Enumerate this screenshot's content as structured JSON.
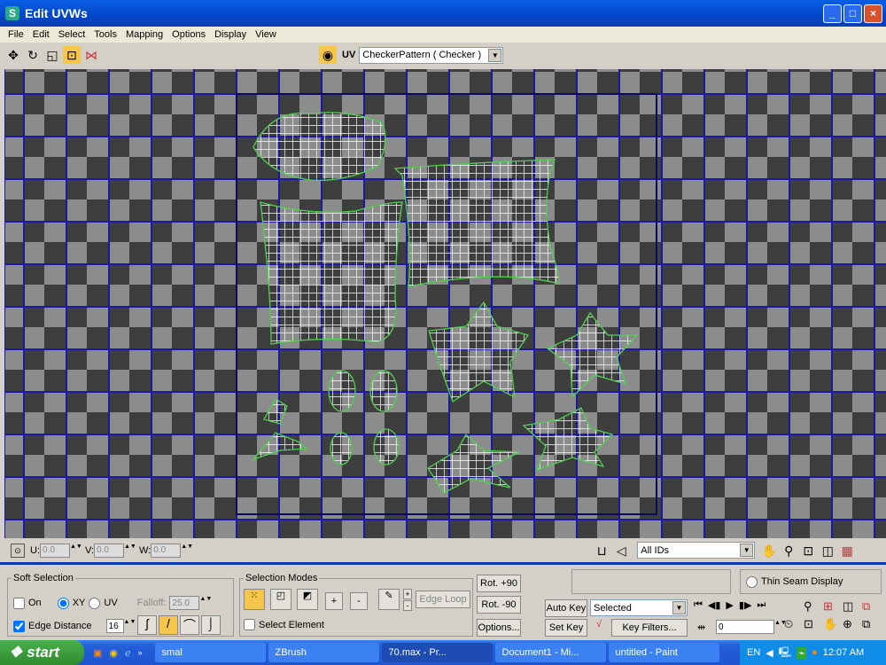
{
  "window": {
    "title": "Edit UVWs",
    "minimize": "_",
    "maximize": "□",
    "close": "×"
  },
  "menu": [
    "File",
    "Edit",
    "Select",
    "Tools",
    "Mapping",
    "Options",
    "Display",
    "View"
  ],
  "toolbar": {
    "uv_label": "UV",
    "texture": "CheckerPattern  ( Checker )"
  },
  "coords": {
    "u_label": "U:",
    "u": "0.0",
    "v_label": "V:",
    "v": "0.0",
    "w_label": "W:",
    "w": "0.0"
  },
  "ids": {
    "value": "All IDs"
  },
  "soft_selection": {
    "title": "Soft Selection",
    "on_label": "On",
    "on": false,
    "xy_label": "XY",
    "uv_label": "UV",
    "mode": "XY",
    "falloff_label": "Falloff:",
    "falloff": "25.0",
    "edge_distance_label": "Edge Distance",
    "edge_distance_checked": true,
    "edge_distance": "16"
  },
  "selection_modes": {
    "title": "Selection Modes",
    "plus": "+",
    "minus": "-",
    "edge_loop": "Edge Loop",
    "select_element": "Select Element"
  },
  "rotate": {
    "plus": "Rot. +90",
    "minus": "Rot. -90",
    "options": "Options..."
  },
  "thin_seam": "Thin Seam Display",
  "anim": {
    "auto_key": "Auto Key",
    "set_key": "Set Key",
    "selected": "Selected",
    "key_filters": "Key Filters...",
    "frame": "0"
  },
  "taskbar": {
    "start": "start",
    "tasks": [
      "smal",
      "ZBrush",
      "70.max    - Pr...",
      "Document1 - Mi...",
      "untitled - Paint"
    ],
    "lang": "EN",
    "clock": "12:07 AM"
  },
  "colors": {
    "accent": "#f5c64a",
    "grid_line": "#1a1aa0",
    "edge": "#40c040"
  }
}
